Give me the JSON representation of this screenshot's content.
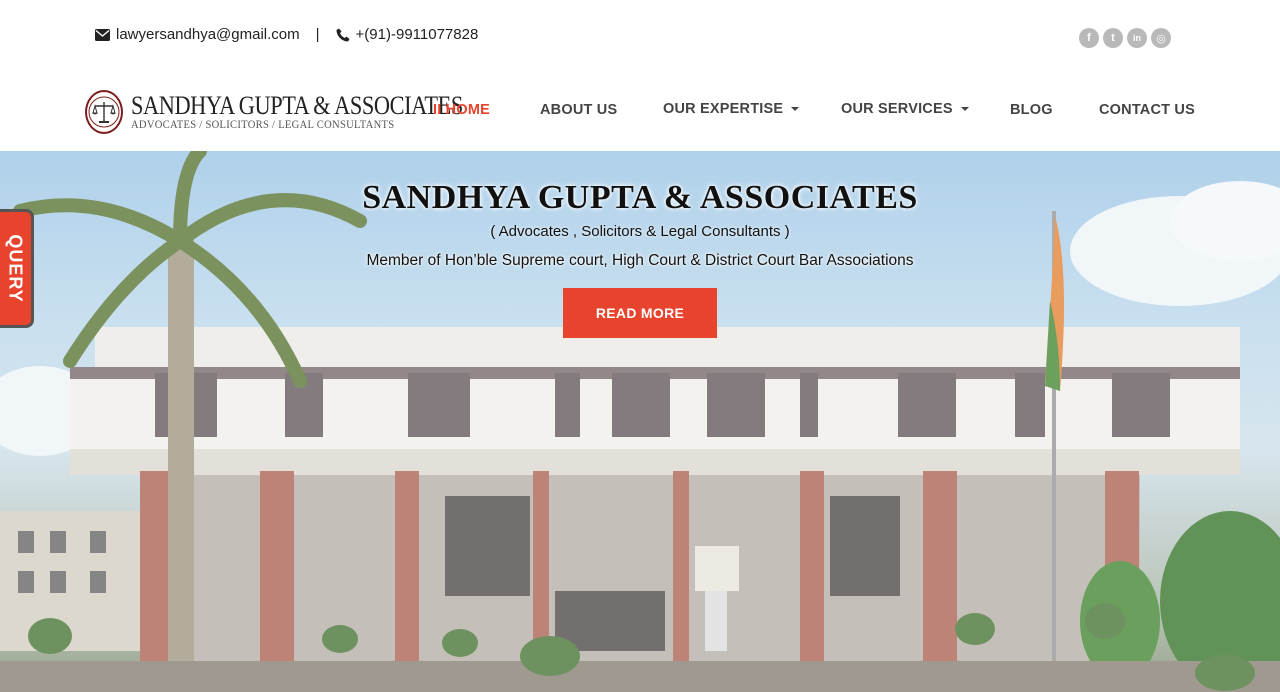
{
  "topbar": {
    "email": "lawyersandhya@gmail.com",
    "separator": "|",
    "phone": "+(91)-9911077828",
    "social": [
      {
        "icon": "facebook-icon",
        "glyph": "f"
      },
      {
        "icon": "twitter-icon",
        "glyph": "t"
      },
      {
        "icon": "linkedin-icon",
        "glyph": "in"
      },
      {
        "icon": "instagram-icon",
        "glyph": "◎"
      }
    ]
  },
  "logo": {
    "name": "SANDHYA GUPTA & ASSOCIATES",
    "tagline": "ADVOCATES / SOLICITORS / LEGAL CONSULTANTS"
  },
  "nav": {
    "items": [
      {
        "label": "II HOME",
        "active": true
      },
      {
        "label": "ABOUT US"
      },
      {
        "label": "OUR EXPERTISE",
        "dropdown": true
      },
      {
        "label": "OUR SERVICES",
        "dropdown": true
      },
      {
        "label": "BLOG"
      },
      {
        "label": "CONTACT US"
      }
    ]
  },
  "hero": {
    "title": "SANDHYA GUPTA & ASSOCIATES",
    "subtitle": "( Advocates , Solicitors & Legal Consultants )",
    "line": "Member of Hon’ble Supreme court, High Court & District Court Bar Associations",
    "button": "READ MORE"
  },
  "query_tab": "QUERY",
  "colors": {
    "accent": "#e8432d",
    "nav_text": "#444444"
  }
}
